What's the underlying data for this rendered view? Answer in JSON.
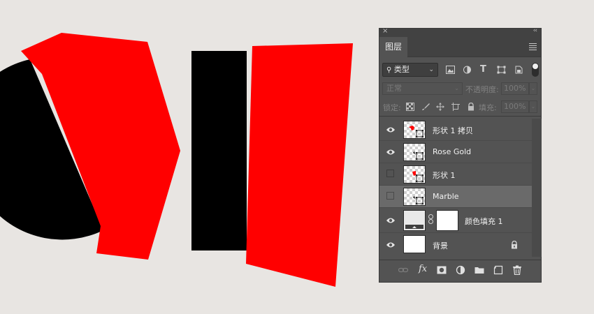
{
  "canvas": {
    "background": "#e8e5e2",
    "shape_colors": {
      "red": "#ff0000",
      "black": "#000000"
    }
  },
  "panel": {
    "tab_title": "图层",
    "filter": {
      "selected": "类型"
    },
    "blend_mode": "正常",
    "opacity_label": "不透明度:",
    "opacity_value": "100%",
    "lock_label": "锁定:",
    "fill_label": "填充:",
    "fill_value": "100%",
    "layers": [
      {
        "name": "形状 1 拷贝",
        "visible": true,
        "thumb": "shape"
      },
      {
        "name": "Rose Gold",
        "visible": true,
        "thumb": "shape"
      },
      {
        "name": "形状 1",
        "visible": false,
        "thumb": "shape"
      },
      {
        "name": "Marble",
        "visible": false,
        "thumb": "shape",
        "selected": true
      },
      {
        "name": "颜色填充 1",
        "visible": true,
        "thumb": "fill"
      },
      {
        "name": "背景",
        "visible": true,
        "thumb": "solid",
        "locked": true
      }
    ],
    "bottom_icons": [
      "link-icon",
      "fx-icon",
      "mask-icon",
      "adjustment-icon",
      "folder-icon",
      "new-layer-icon",
      "trash-icon"
    ]
  }
}
